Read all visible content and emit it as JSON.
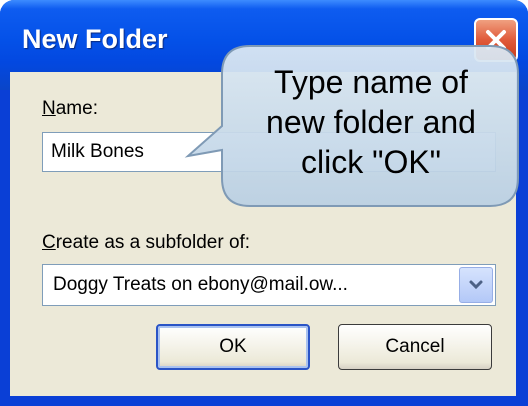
{
  "dialog": {
    "title": "New Folder",
    "name_label": "Name:",
    "name_value": "Milk Bones",
    "subfolder_label": "Create as a subfolder of:",
    "subfolder_value": "Doggy Treats on ebony@mail.ow...",
    "ok_label": "OK",
    "cancel_label": "Cancel"
  },
  "callout": {
    "lines": [
      "Type name of",
      "new folder and",
      "click \"OK\""
    ]
  },
  "colors": {
    "titlebar": "#0451e8",
    "client": "#ece9d8",
    "close_button": "#e05a3a",
    "callout_fill": "#c9dcec"
  },
  "icons": {
    "close": "close-icon",
    "dropdown": "chevron-down-icon"
  }
}
